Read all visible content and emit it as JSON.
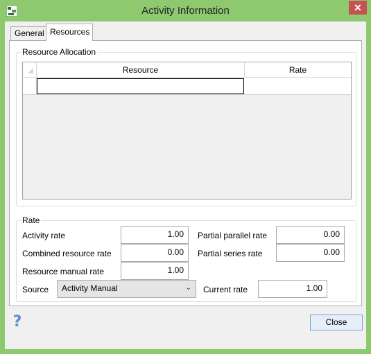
{
  "window": {
    "title": "Activity Information",
    "close_glyph": "✕"
  },
  "tabs": [
    {
      "label": "General",
      "active": false
    },
    {
      "label": "Resources",
      "active": true
    }
  ],
  "resource_allocation": {
    "group_label": "Resource Allocation",
    "columns": [
      "Resource",
      "Rate"
    ],
    "rows": [
      {
        "resource": "",
        "rate": ""
      }
    ]
  },
  "rate": {
    "group_label": "Rate",
    "activity_rate": {
      "label": "Activity rate",
      "value": "1.00"
    },
    "combined_resource_rate": {
      "label": "Combined resource rate",
      "value": "0.00"
    },
    "resource_manual_rate": {
      "label": "Resource manual rate",
      "value": "1.00"
    },
    "partial_parallel_rate": {
      "label": "Partial parallel rate",
      "value": "0.00"
    },
    "partial_series_rate": {
      "label": "Partial series rate",
      "value": "0.00"
    },
    "source": {
      "label": "Source",
      "value": "Activity Manual"
    },
    "current_rate": {
      "label": "Current rate",
      "value": "1.00"
    }
  },
  "footer": {
    "help_glyph": "?",
    "close_label": "Close"
  },
  "colors": {
    "titlebar": "#8fc96f",
    "close_button_red": "#c75050",
    "help_blue": "#5a8fd0"
  }
}
